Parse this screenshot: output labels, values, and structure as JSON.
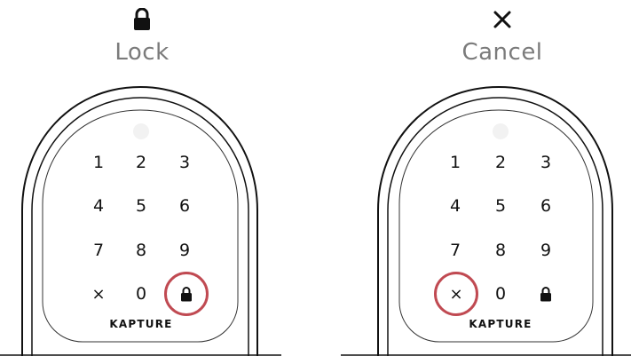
{
  "panels": [
    {
      "id": "lock",
      "header_icon": "lock-icon",
      "header_label": "Lock",
      "highlighted_key": "lock",
      "keys": [
        "1",
        "2",
        "3",
        "4",
        "5",
        "6",
        "7",
        "8",
        "9",
        "×",
        "0",
        "lock"
      ],
      "brand": "KAPTURE"
    },
    {
      "id": "cancel",
      "header_icon": "cancel-x-icon",
      "header_label": "Cancel",
      "highlighted_key": "×",
      "keys": [
        "1",
        "2",
        "3",
        "4",
        "5",
        "6",
        "7",
        "8",
        "9",
        "×",
        "0",
        "lock"
      ],
      "brand": "KAPTURE"
    }
  ],
  "colors": {
    "highlight": "#c04a52",
    "label": "#7b7b7b",
    "outline": "#111111"
  }
}
